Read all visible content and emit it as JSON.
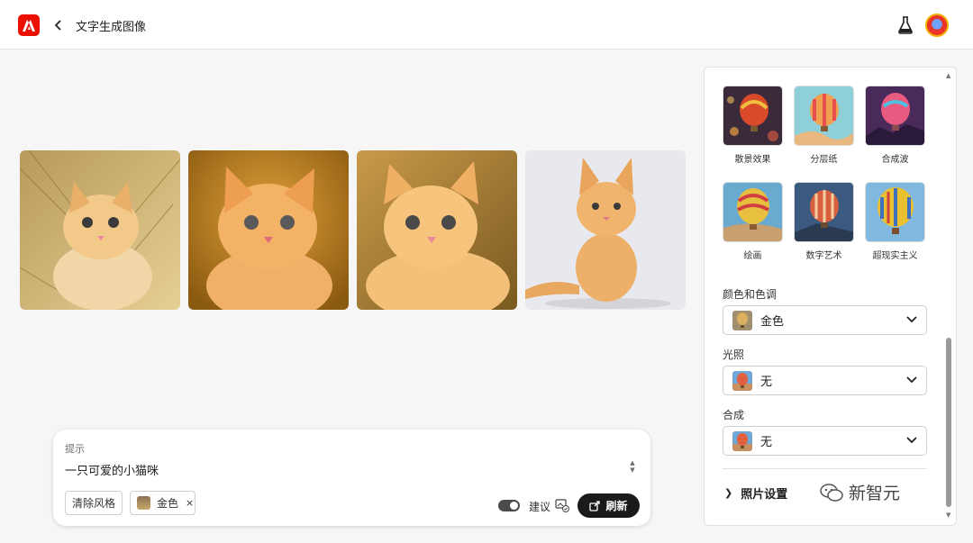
{
  "header": {
    "title": "文字生成图像"
  },
  "images": [
    {
      "name": "kitten-1"
    },
    {
      "name": "kitten-2"
    },
    {
      "name": "kitten-3"
    },
    {
      "name": "kitten-4"
    }
  ],
  "prompt": {
    "label": "提示",
    "value": "一只可爱的小猫咪",
    "clear_style": "清除风格",
    "chip_label": "金色",
    "chip_remove": "×",
    "suggest_label": "建议",
    "refresh_label": "刷新"
  },
  "panel": {
    "effects": [
      {
        "label": "散景效果"
      },
      {
        "label": "分层纸"
      },
      {
        "label": "合成波"
      },
      {
        "label": "绘画"
      },
      {
        "label": "数字艺术"
      },
      {
        "label": "超现实主义"
      }
    ],
    "color_tone": {
      "label": "颜色和色调",
      "value": "金色"
    },
    "lighting": {
      "label": "光照",
      "value": "无"
    },
    "composition": {
      "label": "合成",
      "value": "无"
    },
    "photo_settings": "照片设置",
    "watermark": "新智元"
  },
  "colors": {
    "brand": "#eb1000",
    "dark_button": "#1a1a1a"
  }
}
